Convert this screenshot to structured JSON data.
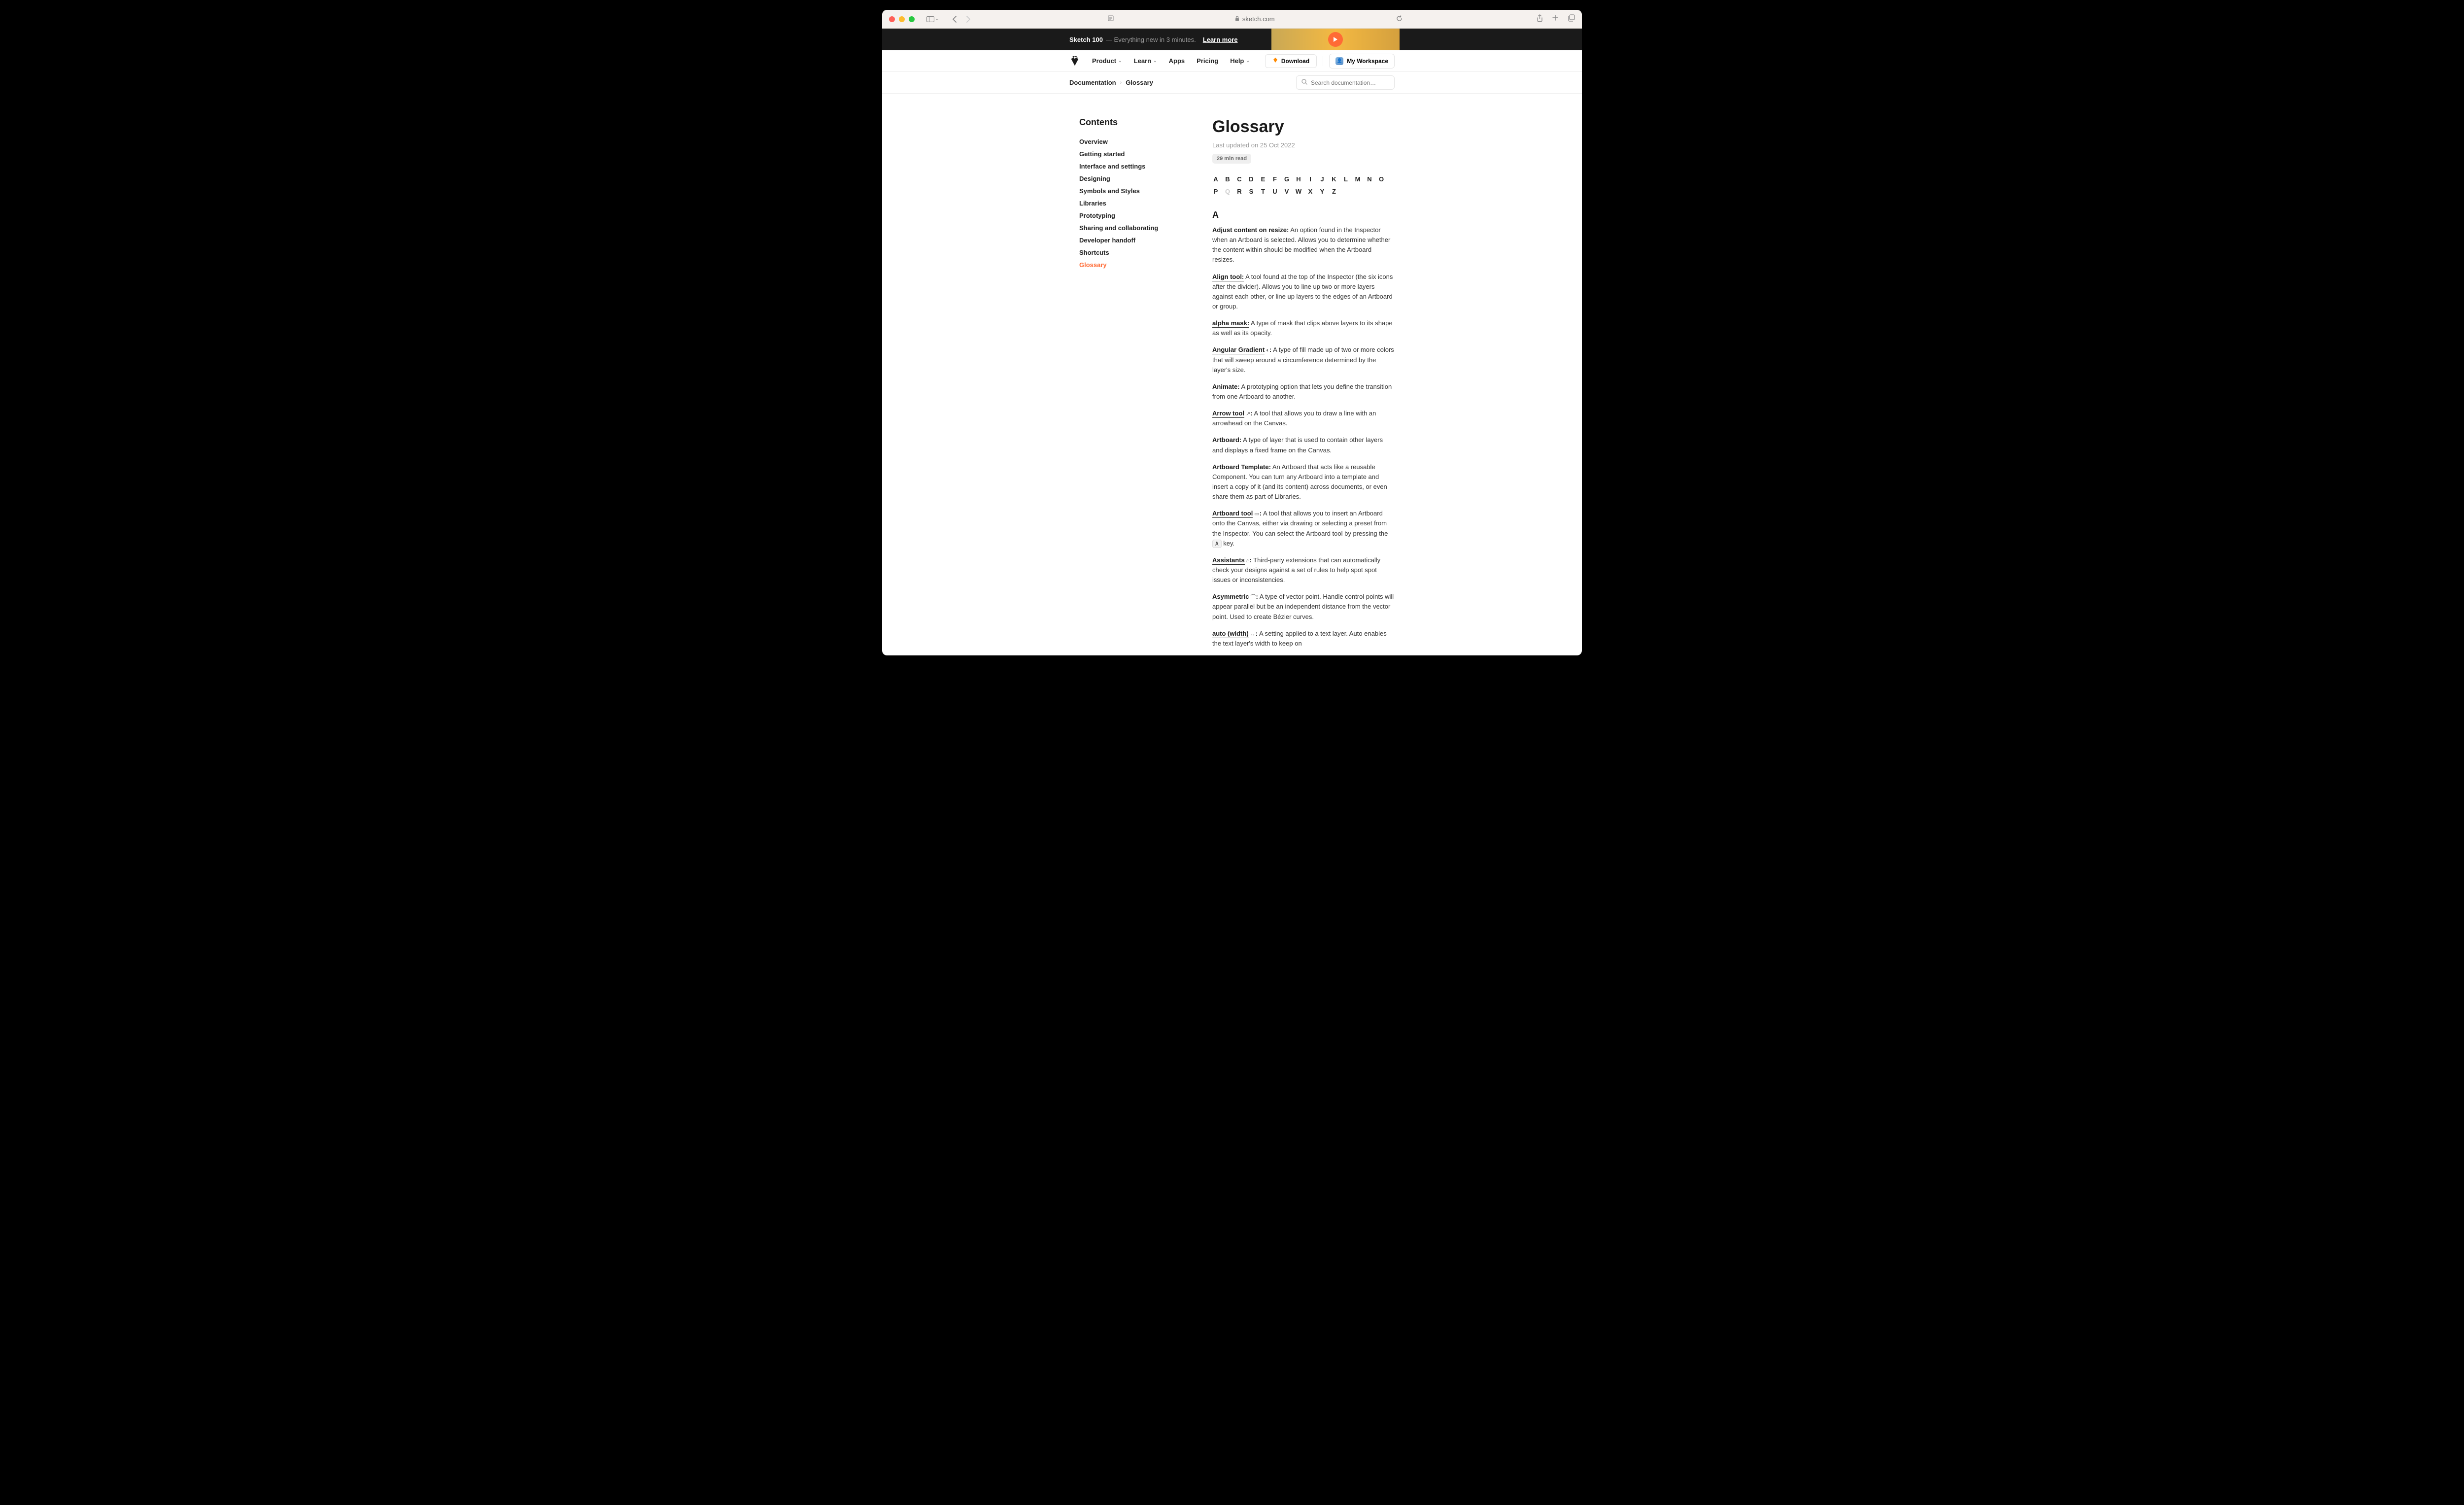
{
  "browser": {
    "url": "sketch.com"
  },
  "banner": {
    "title": "Sketch 100",
    "subtitle": "— Everything new in 3 minutes.",
    "cta": "Learn more"
  },
  "nav": {
    "items": [
      {
        "label": "Product",
        "dropdown": true
      },
      {
        "label": "Learn",
        "dropdown": true
      },
      {
        "label": "Apps",
        "dropdown": false
      },
      {
        "label": "Pricing",
        "dropdown": false
      },
      {
        "label": "Help",
        "dropdown": true
      }
    ],
    "download": "Download",
    "workspace": "My Workspace"
  },
  "breadcrumb": {
    "items": [
      "Documentation",
      "Glossary"
    ]
  },
  "search": {
    "placeholder": "Search documentation…"
  },
  "sidebar": {
    "title": "Contents",
    "items": [
      {
        "label": "Overview",
        "active": false
      },
      {
        "label": "Getting started",
        "active": false
      },
      {
        "label": "Interface and settings",
        "active": false
      },
      {
        "label": "Designing",
        "active": false
      },
      {
        "label": "Symbols and Styles",
        "active": false
      },
      {
        "label": "Libraries",
        "active": false
      },
      {
        "label": "Prototyping",
        "active": false
      },
      {
        "label": "Sharing and collaborating",
        "active": false
      },
      {
        "label": "Developer handoff",
        "active": false
      },
      {
        "label": "Shortcuts",
        "active": false
      },
      {
        "label": "Glossary",
        "active": true
      }
    ]
  },
  "page": {
    "title": "Glossary",
    "updated": "Last updated on 25 Oct 2022",
    "read_time": "29 min read"
  },
  "alphabet": [
    {
      "l": "A",
      "enabled": true
    },
    {
      "l": "B",
      "enabled": true
    },
    {
      "l": "C",
      "enabled": true
    },
    {
      "l": "D",
      "enabled": true
    },
    {
      "l": "E",
      "enabled": true
    },
    {
      "l": "F",
      "enabled": true
    },
    {
      "l": "G",
      "enabled": true
    },
    {
      "l": "H",
      "enabled": true
    },
    {
      "l": "I",
      "enabled": true
    },
    {
      "l": "J",
      "enabled": true
    },
    {
      "l": "K",
      "enabled": true
    },
    {
      "l": "L",
      "enabled": true
    },
    {
      "l": "M",
      "enabled": true
    },
    {
      "l": "N",
      "enabled": true
    },
    {
      "l": "O",
      "enabled": true
    },
    {
      "l": "P",
      "enabled": true
    },
    {
      "l": "Q",
      "enabled": false
    },
    {
      "l": "R",
      "enabled": true
    },
    {
      "l": "S",
      "enabled": true
    },
    {
      "l": "T",
      "enabled": true
    },
    {
      "l": "U",
      "enabled": true
    },
    {
      "l": "V",
      "enabled": true
    },
    {
      "l": "W",
      "enabled": true
    },
    {
      "l": "X",
      "enabled": true
    },
    {
      "l": "Y",
      "enabled": true
    },
    {
      "l": "Z",
      "enabled": true
    }
  ],
  "section": {
    "letter": "A",
    "defs": [
      {
        "term": "Adjust content on resize:",
        "link": false,
        "icon": "",
        "body": " An option found in the Inspector when an Artboard is selected. Allows you to determine whether the content within should be modified when the Artboard resizes."
      },
      {
        "term": "Align tool:",
        "link": true,
        "icon": "",
        "body": " A tool found at the top of the Inspector (the six icons after the divider). Allows you to line up two or more layers against each other, or line up layers to the edges of an Artboard or group."
      },
      {
        "term": "alpha mask:",
        "link": true,
        "icon": "",
        "body": " A type of mask that clips above layers to its shape as well as its opacity."
      },
      {
        "term": "Angular Gradient",
        "link": true,
        "icon": "◐",
        "post": ":",
        "body": " A type of fill made up of two or more colors that will sweep around a circumference determined by the layer's size."
      },
      {
        "term": "Animate:",
        "link": false,
        "icon": "",
        "body": " A prototyping option that lets you define the transition from one Artboard to another."
      },
      {
        "term": "Arrow tool",
        "link": true,
        "icon": "↗",
        "post": ":",
        "body": " A tool that allows you to draw a line with an arrowhead on the Canvas."
      },
      {
        "term": "Artboard:",
        "link": false,
        "icon": "",
        "body": " A type of layer that is used to contain other layers and displays a fixed frame on the Canvas."
      },
      {
        "term": "Artboard Template:",
        "link": false,
        "icon": "",
        "body": " An Artboard that acts like a reusable Component. You can turn any Artboard into a template and insert a copy of it (and its content) across documents, or even share them as part of Libraries."
      },
      {
        "term": "Artboard tool",
        "link": true,
        "icon": "▭",
        "post": ":",
        "body": " A tool that allows you to insert an Artboard onto the Canvas, either via drawing or selecting a preset from the Inspector. You can select the Artboard tool by pressing the ",
        "key": "A",
        "body2": " key."
      },
      {
        "term": "Assistants",
        "link": true,
        "icon": "⌂",
        "post": ":",
        "body": " Third-party extensions that can automatically check your designs against a set of rules to help spot spot issues or inconsistencies."
      },
      {
        "term": "Asymmetric",
        "link": false,
        "icon": "⌒",
        "post": ":",
        "body": " A type of vector point. Handle control points will appear parallel but be an independent distance from the vector point. Used to create Bézier curves."
      },
      {
        "term": "auto (width)",
        "link": true,
        "icon": "↔",
        "post": ":",
        "body": " A setting applied to a text layer. Auto enables the text layer's width to keep on"
      }
    ]
  }
}
